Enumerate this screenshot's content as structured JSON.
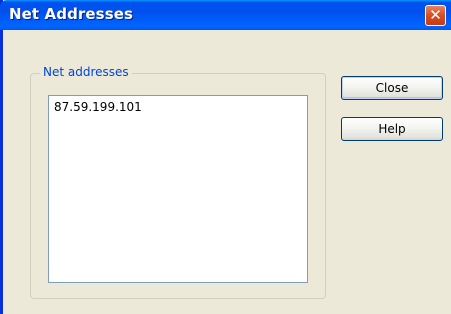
{
  "window": {
    "title": "Net Addresses",
    "close_glyph": "✕"
  },
  "group": {
    "label": "Net addresses"
  },
  "list": {
    "items": [
      "87.59.199.101"
    ]
  },
  "buttons": {
    "close_label": "Close",
    "help_label": "Help"
  },
  "icons": {
    "title_close": "close-icon"
  },
  "colors": {
    "title_bar": "#0050ee",
    "window_bg": "#ece9d8",
    "group_label": "#0046d5",
    "close_button": "#d94d23"
  }
}
